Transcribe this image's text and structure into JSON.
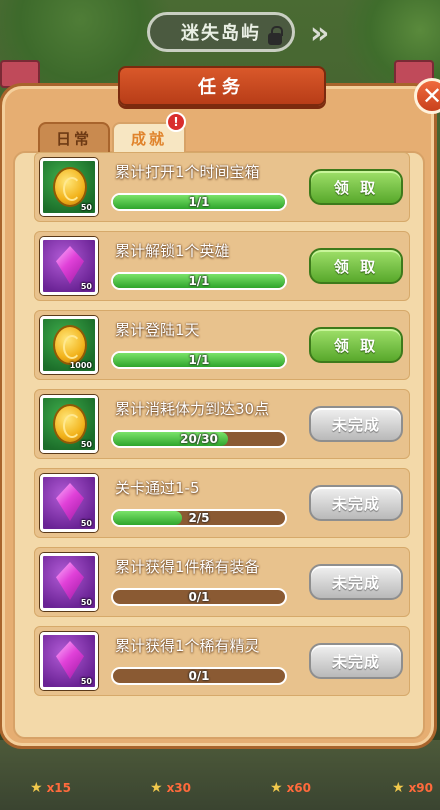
{
  "header": {
    "location": "迷失岛屿",
    "forward_arrows": "»"
  },
  "panel": {
    "title": "任务",
    "close_glyph": "✕",
    "tabs": [
      {
        "label": "日常",
        "active": false
      },
      {
        "label": "成就",
        "active": true,
        "badge": "!"
      }
    ]
  },
  "tasks": [
    {
      "title": "累计打开1个时间宝箱",
      "reward_icon": "gold-coin-icon",
      "reward_qty": "50",
      "progress_text": "1/1",
      "progress": 1.0,
      "button": "领 取",
      "state": "claim"
    },
    {
      "title": "累计解锁1个英雄",
      "reward_icon": "purple-gem-icon",
      "reward_qty": "50",
      "progress_text": "1/1",
      "progress": 1.0,
      "button": "领 取",
      "state": "claim"
    },
    {
      "title": "累计登陆1天",
      "reward_icon": "gold-coin-icon",
      "reward_qty": "1000",
      "progress_text": "1/1",
      "progress": 1.0,
      "button": "领 取",
      "state": "claim"
    },
    {
      "title": "累计消耗体力到达30点",
      "reward_icon": "gold-coin-icon",
      "reward_qty": "50",
      "progress_text": "20/30",
      "progress": 0.667,
      "button": "未完成",
      "state": "incomplete"
    },
    {
      "title": "关卡通过1-5",
      "reward_icon": "purple-gem-icon",
      "reward_qty": "50",
      "progress_text": "2/5",
      "progress": 0.4,
      "button": "未完成",
      "state": "incomplete"
    },
    {
      "title": "累计获得1件稀有装备",
      "reward_icon": "purple-gem-icon",
      "reward_qty": "50",
      "progress_text": "0/1",
      "progress": 0.0,
      "button": "未完成",
      "state": "incomplete"
    },
    {
      "title": "累计获得1个稀有精灵",
      "reward_icon": "purple-gem-icon",
      "reward_qty": "50",
      "progress_text": "0/1",
      "progress": 0.0,
      "button": "未完成",
      "state": "incomplete"
    }
  ],
  "bottom_bar": [
    {
      "label": "x15"
    },
    {
      "label": "x30"
    },
    {
      "label": "x60"
    },
    {
      "label": "x90"
    }
  ],
  "colors": {
    "claim_green": "#58a82b",
    "progress_green": "#2fa52c",
    "title_red": "#b83d18"
  }
}
